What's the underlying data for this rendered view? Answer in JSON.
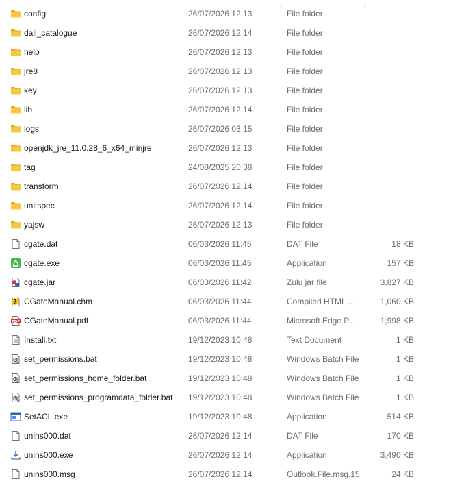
{
  "colors": {
    "folder": "#f8c940",
    "folder_dark": "#e5a81a",
    "text": "#1a1a1a",
    "secondary_text": "#6d6d6d"
  },
  "files": [
    {
      "name": "config",
      "date": "26/07/2026 12:13",
      "type": "File folder",
      "size": "",
      "icon": "folder-icon"
    },
    {
      "name": "dali_catalogue",
      "date": "26/07/2026 12:14",
      "type": "File folder",
      "size": "",
      "icon": "folder-icon"
    },
    {
      "name": "help",
      "date": "26/07/2026 12:13",
      "type": "File folder",
      "size": "",
      "icon": "folder-icon"
    },
    {
      "name": "jre8",
      "date": "26/07/2026 12:13",
      "type": "File folder",
      "size": "",
      "icon": "folder-icon"
    },
    {
      "name": "key",
      "date": "26/07/2026 12:13",
      "type": "File folder",
      "size": "",
      "icon": "folder-icon"
    },
    {
      "name": "lib",
      "date": "26/07/2026 12:14",
      "type": "File folder",
      "size": "",
      "icon": "folder-icon"
    },
    {
      "name": "logs",
      "date": "26/07/2026 03:15",
      "type": "File folder",
      "size": "",
      "icon": "folder-icon"
    },
    {
      "name": "openjdk_jre_11.0.28_6_x64_minjre",
      "date": "26/07/2026 12:13",
      "type": "File folder",
      "size": "",
      "icon": "folder-icon"
    },
    {
      "name": "tag",
      "date": "24/08/2025 20:38",
      "type": "File folder",
      "size": "",
      "icon": "folder-icon"
    },
    {
      "name": "transform",
      "date": "26/07/2026 12:14",
      "type": "File folder",
      "size": "",
      "icon": "folder-icon"
    },
    {
      "name": "unitspec",
      "date": "26/07/2026 12:14",
      "type": "File folder",
      "size": "",
      "icon": "folder-icon"
    },
    {
      "name": "yajsw",
      "date": "26/07/2026 12:13",
      "type": "File folder",
      "size": "",
      "icon": "folder-icon"
    },
    {
      "name": "cgate.dat",
      "date": "06/03/2026 11:45",
      "type": "DAT File",
      "size": "18 KB",
      "icon": "blank-file-icon"
    },
    {
      "name": "cgate.exe",
      "date": "06/03/2026 11:45",
      "type": "Application",
      "size": "157 KB",
      "icon": "green-app-icon"
    },
    {
      "name": "cgate.jar",
      "date": "06/03/2026 11:42",
      "type": "Zulu jar file",
      "size": "3,827 KB",
      "icon": "jar-file-icon"
    },
    {
      "name": "CGateManual.chm",
      "date": "06/03/2026 11:44",
      "type": "Compiled HTML ...",
      "size": "1,060 KB",
      "icon": "help-file-icon"
    },
    {
      "name": "CGateManual.pdf",
      "date": "06/03/2026 11:44",
      "type": "Microsoft Edge P...",
      "size": "1,998 KB",
      "icon": "pdf-file-icon"
    },
    {
      "name": "Install.txt",
      "date": "19/12/2023 10:48",
      "type": "Text Document",
      "size": "1 KB",
      "icon": "text-file-icon"
    },
    {
      "name": "set_permissions.bat",
      "date": "19/12/2023 10:48",
      "type": "Windows Batch File",
      "size": "1 KB",
      "icon": "batch-file-icon"
    },
    {
      "name": "set_permissions_home_folder.bat",
      "date": "19/12/2023 10:48",
      "type": "Windows Batch File",
      "size": "1 KB",
      "icon": "batch-file-icon"
    },
    {
      "name": "set_permissions_programdata_folder.bat",
      "date": "19/12/2023 10:48",
      "type": "Windows Batch File",
      "size": "1 KB",
      "icon": "batch-file-icon"
    },
    {
      "name": "SetACL.exe",
      "date": "19/12/2023 10:48",
      "type": "Application",
      "size": "514 KB",
      "icon": "blue-app-icon"
    },
    {
      "name": "unins000.dat",
      "date": "26/07/2026 12:14",
      "type": "DAT File",
      "size": "170 KB",
      "icon": "blank-file-icon"
    },
    {
      "name": "unins000.exe",
      "date": "26/07/2026 12:14",
      "type": "Application",
      "size": "3,490 KB",
      "icon": "installer-icon"
    },
    {
      "name": "unins000.msg",
      "date": "26/07/2026 12:14",
      "type": "Outlook.File.msg.15",
      "size": "24 KB",
      "icon": "blank-file-icon"
    }
  ]
}
